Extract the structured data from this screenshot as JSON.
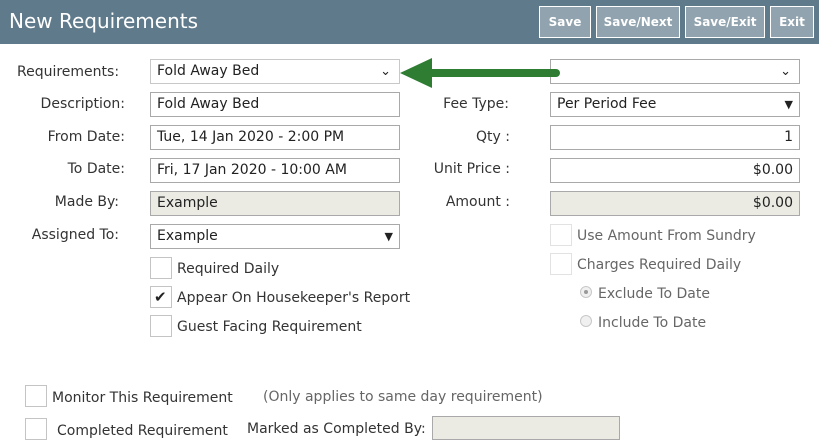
{
  "header": {
    "title": "New Requirements",
    "buttons": {
      "save": "Save",
      "save_next": "Save/Next",
      "save_exit": "Save/Exit",
      "exit": "Exit"
    }
  },
  "form": {
    "requirements": {
      "label": "Requirements:",
      "value": "Fold Away Bed"
    },
    "description": {
      "label": "Description:",
      "value": "Fold Away Bed"
    },
    "from_date": {
      "label": "From Date:",
      "value": "Tue, 14 Jan 2020 - 2:00 PM"
    },
    "to_date": {
      "label": "To Date:",
      "value": "Fri, 17 Jan 2020 - 10:00 AM"
    },
    "made_by": {
      "label": "Made By:",
      "value": "Example"
    },
    "assigned_to": {
      "label": "Assigned To:",
      "value": "Example"
    },
    "right": {
      "top_select_value": "",
      "fee_type": {
        "label": "Fee Type:",
        "value": "Per Period Fee"
      },
      "qty": {
        "label": "Qty :",
        "value": "1"
      },
      "unit_price": {
        "label": "Unit Price :",
        "value": "$0.00"
      },
      "amount": {
        "label": "Amount :",
        "value": "$0.00"
      }
    },
    "checkboxes": {
      "required_daily": {
        "label": "Required Daily",
        "checked": false
      },
      "appear_housekeeper": {
        "label": "Appear On Housekeeper's Report",
        "checked": true
      },
      "guest_facing": {
        "label": "Guest Facing Requirement",
        "checked": false
      },
      "use_amount_sundry": {
        "label": "Use Amount From Sundry",
        "checked": false
      },
      "charges_required_daily": {
        "label": "Charges Required Daily",
        "checked": false
      }
    },
    "radios": {
      "exclude_to_date": {
        "label": "Exclude To Date",
        "selected": true
      },
      "include_to_date": {
        "label": "Include To Date",
        "selected": false
      }
    },
    "monitor": {
      "label": "Monitor This Requirement",
      "note": "(Only applies to same day requirement)"
    },
    "completed": {
      "label": "Completed Requirement",
      "marked_by_label": "Marked as Completed By:",
      "marked_by_value": ""
    }
  },
  "colors": {
    "header_bg": "#5f7a8b",
    "button_bg": "#91a3ae",
    "arrow": "#2e7d32",
    "readonly_bg": "#ebebe4"
  },
  "icons": {
    "select_chevron": "chevron-down-icon",
    "select_caret": "caret-down-icon",
    "check": "check-icon",
    "annotation": "arrow-left-icon"
  }
}
